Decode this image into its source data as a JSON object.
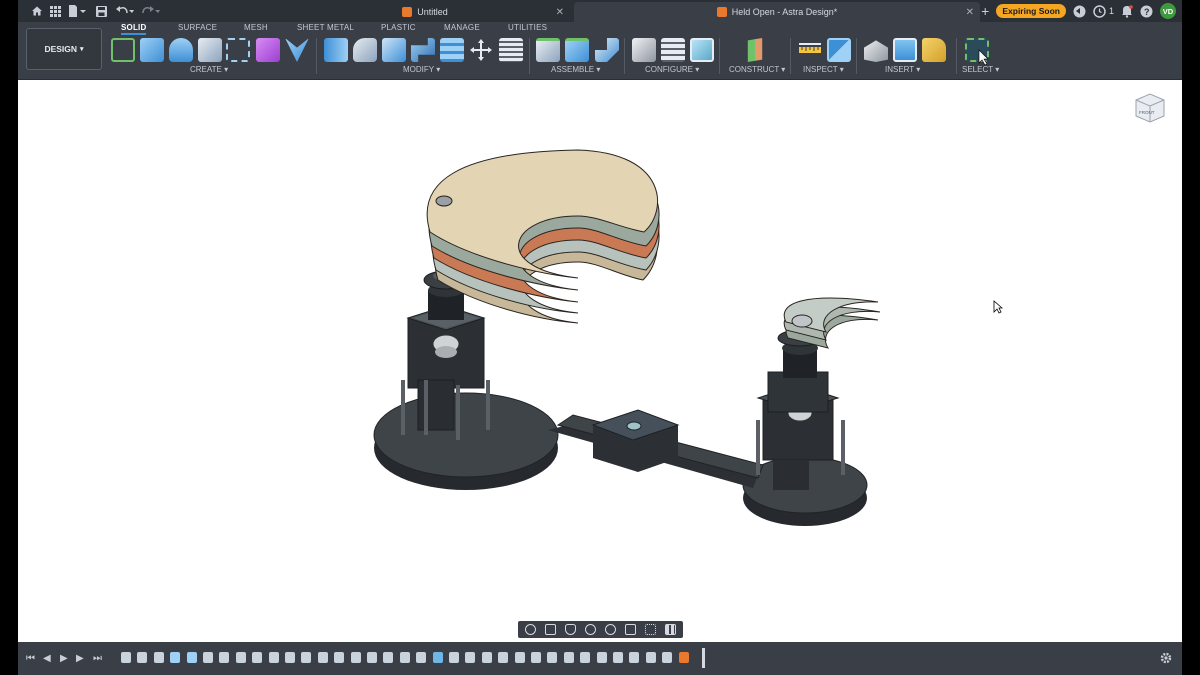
{
  "tabs": {
    "untitled": {
      "label": "Untitled"
    },
    "active": {
      "label": "Held Open - Astra Design*"
    }
  },
  "titlebar": {
    "expiring_label": "Expiring Soon",
    "notification_count": "1",
    "avatar_initials": "VD"
  },
  "workspace": {
    "button_label": "DESIGN",
    "tabs": [
      "SOLID",
      "SURFACE",
      "MESH",
      "SHEET METAL",
      "PLASTIC",
      "MANAGE",
      "UTILITIES"
    ],
    "groups": [
      "CREATE",
      "MODIFY",
      "ASSEMBLE",
      "CONFIGURE",
      "CONSTRUCT",
      "INSPECT",
      "INSERT",
      "SELECT"
    ]
  },
  "viewcube": {
    "label": "FRONT"
  },
  "colors": {
    "accent": "#3d8fd6",
    "toolbar_bg": "#3a3f47",
    "titlebar_bg": "#2b2f36",
    "expiring_badge": "#f5a623",
    "brand_orange": "#e8792d"
  }
}
